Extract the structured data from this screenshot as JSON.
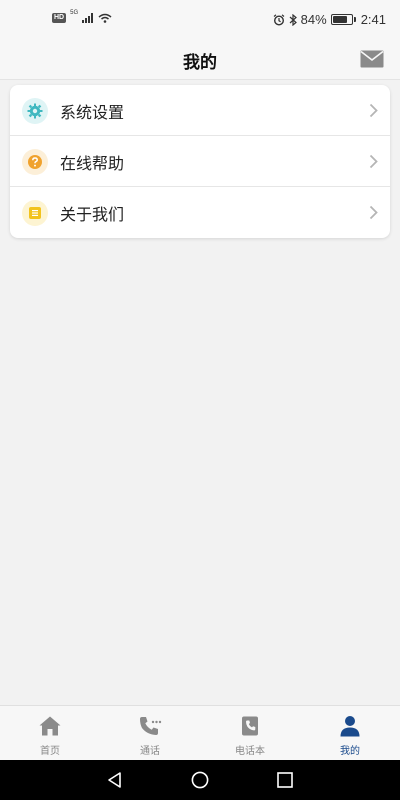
{
  "status_bar": {
    "left_badge": "HD",
    "network": "5G",
    "battery_percent": "84%",
    "battery_level": 0.84,
    "time": "2:41"
  },
  "header": {
    "title": "我的",
    "mail_icon": "mail-icon"
  },
  "menu": {
    "items": [
      {
        "label": "系统设置",
        "icon": "gear-icon",
        "icon_color": "#3fb8c0",
        "icon_bg": "#dff4f5"
      },
      {
        "label": "在线帮助",
        "icon": "question-icon",
        "icon_color": "#f0a22e",
        "icon_bg": "#fcefd8"
      },
      {
        "label": "关于我们",
        "icon": "document-icon",
        "icon_color": "#f2c31d",
        "icon_bg": "#fdf4d2"
      }
    ]
  },
  "tabs": [
    {
      "label": "首页",
      "icon": "home-icon",
      "active": false
    },
    {
      "label": "通话",
      "icon": "phone-icon",
      "active": false
    },
    {
      "label": "电话本",
      "icon": "phonebook-icon",
      "active": false
    },
    {
      "label": "我的",
      "icon": "user-icon",
      "active": true
    }
  ],
  "colors": {
    "active_tab": "#1a4a8c",
    "inactive_tab": "#888888",
    "page_background": "#f2f2f2"
  },
  "system_nav": {
    "back_icon": "back-icon",
    "home_icon": "circle-home-icon",
    "recents_icon": "recents-icon"
  }
}
